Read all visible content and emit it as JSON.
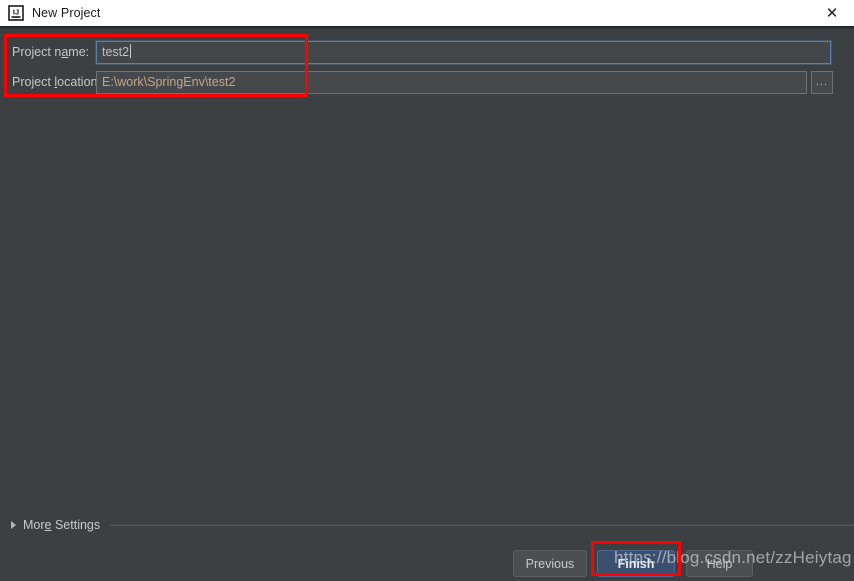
{
  "window": {
    "title": "New Project",
    "icon": "intellij-idea-icon",
    "close_label": "✕",
    "titlebar_bg": "#ffffff",
    "body_bg": "#3c4043"
  },
  "form": {
    "name_field": {
      "label_before": "Project n",
      "label_mnemonic": "a",
      "label_after": "me:",
      "label_full": "Project name:",
      "value": "test2",
      "placeholder": "",
      "focused": true
    },
    "location_field": {
      "label_before": "Project ",
      "label_mnemonic": "l",
      "label_after": "ocation:",
      "label_full": "Project location:",
      "value": "E:\\work\\SpringEnv\\test2",
      "placeholder": "",
      "browse_label": "..."
    }
  },
  "more_settings": {
    "label_before": "Mor",
    "label_mnemonic": "e",
    "label_after": " Settings",
    "label_full": "More Settings",
    "expanded": false,
    "chevron": "triangle-right-icon"
  },
  "buttons": {
    "previous": "Previous",
    "finish": "Finish",
    "help": "Help"
  },
  "annotations": {
    "fields_box_color": "#ff0000",
    "finish_box_color": "#ff0000"
  },
  "watermark": {
    "text": "https://blog.csdn.net/zzHeiytag"
  }
}
